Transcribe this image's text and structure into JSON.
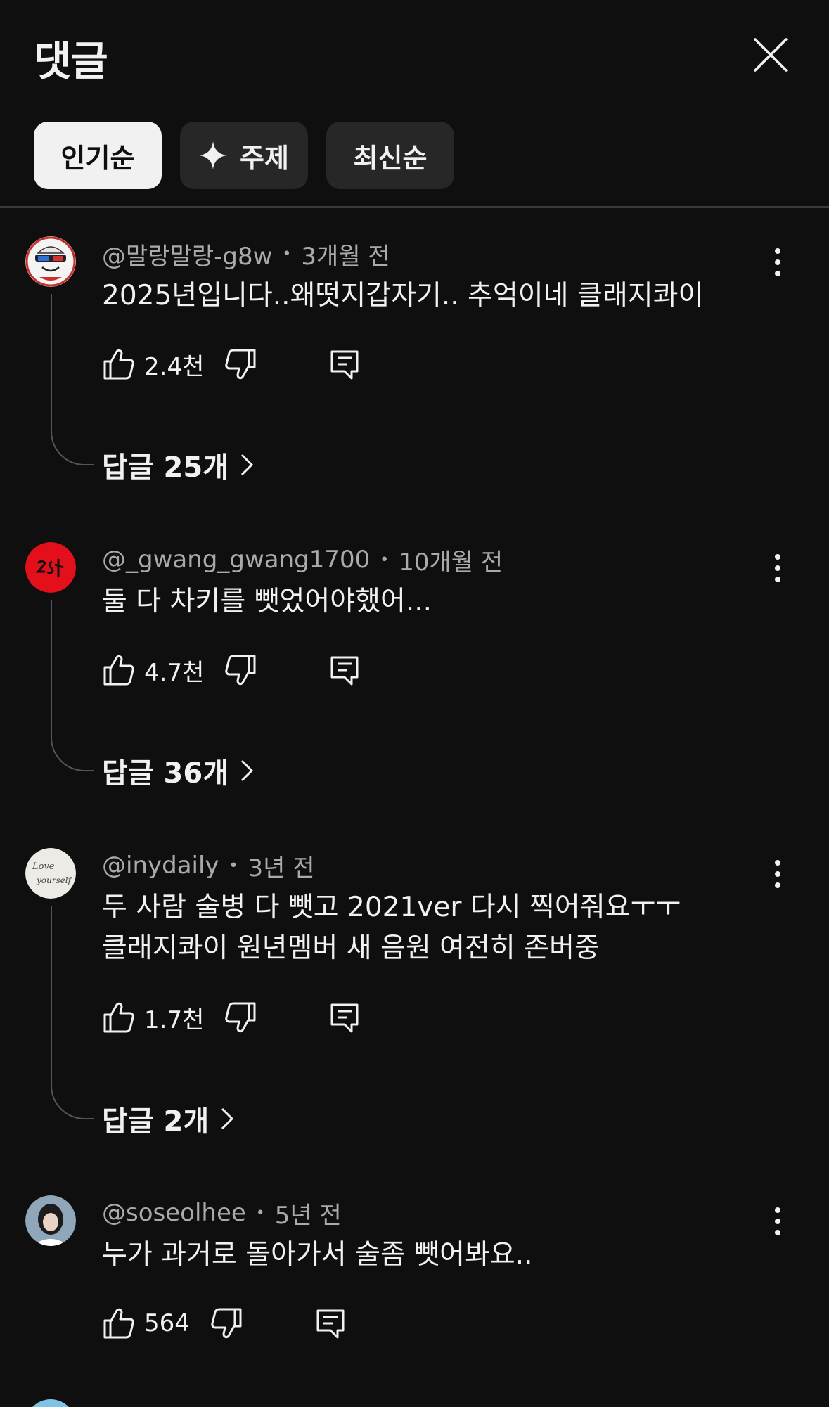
{
  "header": {
    "title": "댓글",
    "close_icon": "close-icon"
  },
  "chips": [
    {
      "label": "인기순",
      "active": true
    },
    {
      "label": "주제",
      "icon": "sparkle-icon",
      "active": false
    },
    {
      "label": "최신순",
      "active": false
    }
  ],
  "comments": [
    {
      "author": "@말랑말랑-g8w",
      "time": "3개월 전",
      "text": "2025년입니다..왜떳지갑자기.. 추억이네 클래지콰이",
      "likes": "2.4천",
      "replies": "답글 25개",
      "avatar": "3d-glasses-cartoon-avatar"
    },
    {
      "author": "@_gwang_gwang1700",
      "time": "10개월 전",
      "text": "둘 다 차키를 뺏었어야했어...",
      "likes": "4.7천",
      "replies": "답글 36개",
      "avatar": "red-logo-avatar"
    },
    {
      "author": "@inydaily",
      "time": "3년 전",
      "text": "두 사람 술병 다 뺏고 2021ver 다시 찍어줘요ㅜㅜ\n클래지콰이 원년멤버 새 음원 여전히 존버중",
      "likes": "1.7천",
      "replies": "답글 2개",
      "avatar": "handwritten-avatar"
    },
    {
      "author": "@soseolhee",
      "time": "5년 전",
      "text": "누가 과거로 돌아가서 술좀 뺏어봐요..",
      "likes": "564",
      "avatar": "photo-avatar"
    }
  ],
  "colors": {
    "background": "#0f0f0f",
    "chip": "#272727",
    "chip_active": "#f1f1f1",
    "text": "#f1f1f1",
    "secondary_text": "#aaaaaa"
  }
}
